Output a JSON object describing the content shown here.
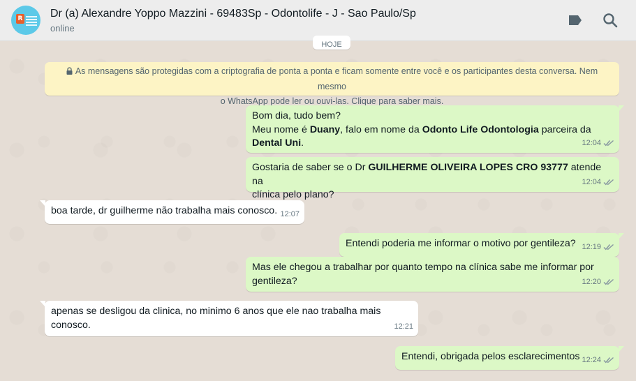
{
  "header": {
    "avatar_mark": "R",
    "contact_name": "Dr (a) Alexandre Yoppo Mazzini - 69483Sp - Odontolife - J - Sao Paulo/Sp",
    "status": "online",
    "icons": [
      "label-icon",
      "search-icon"
    ]
  },
  "chat": {
    "date_chip": "HOJE",
    "encryption_notice_line1": "As mensagens são protegidas com a criptografia de ponta a ponta e ficam somente entre você e os participantes desta conversa. Nem mesmo",
    "encryption_notice_line2": "o WhatsApp pode ler ou ouvi-las. Clique para saber mais.",
    "messages": [
      {
        "direction": "out",
        "line1": "Bom dia, tudo bem?",
        "line2_a": "Meu nome é ",
        "line2_b": "Duany",
        "line2_c": ", falo em nome da ",
        "line2_d": "Odonto Life Odontologia",
        "line2_e": " parceira da",
        "line3_a": "Dental Uni",
        "line3_b": ".",
        "time": "12:04"
      },
      {
        "direction": "out",
        "line1_a": "Gostaria de saber se o Dr ",
        "line1_b": "GUILHERME OLIVEIRA LOPES CRO 93777",
        "line1_c": " atende na",
        "line2": "clínica pelo plano?",
        "time": "12:04"
      },
      {
        "direction": "in",
        "text": "boa tarde, dr guilherme não trabalha mais conosco.",
        "time": "12:07"
      },
      {
        "direction": "out",
        "text": "Entendi poderia me informar o motivo por gentileza?",
        "time": "12:19"
      },
      {
        "direction": "out",
        "line1": "Mas ele chegou a trabalhar por quanto tempo na clínica sabe me informar por",
        "line2": "gentileza?",
        "time": "12:20"
      },
      {
        "direction": "in",
        "line1": "apenas se desligou da clinica, no minimo 6 anos que ele nao trabalha mais",
        "line2": "conosco.",
        "time": "12:21"
      },
      {
        "direction": "out",
        "text": "Entendi, obrigada pelos esclarecimentos",
        "time": "12:24"
      }
    ]
  },
  "colors": {
    "outgoing_bubble": "#dcf8c6",
    "incoming_bubble": "#ffffff",
    "chat_background": "#e5ddd5",
    "read_ticks": "#8696a0",
    "encryption_banner": "#fdf4c5"
  }
}
